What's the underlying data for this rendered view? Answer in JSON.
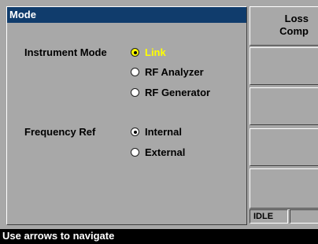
{
  "panel": {
    "title": "Mode",
    "instrument_mode": {
      "label": "Instrument Mode",
      "options": [
        "Link",
        "RF Analyzer",
        "RF Generator"
      ],
      "selected": "Link"
    },
    "frequency_ref": {
      "label": "Frequency Ref",
      "options": [
        "Internal",
        "External"
      ],
      "selected": "Internal"
    }
  },
  "softkeys": {
    "key1": {
      "line1": "Loss",
      "line2": "Comp"
    }
  },
  "status": {
    "state": "IDLE",
    "extra": ""
  },
  "hint": "Use arrows to navigate",
  "colors": {
    "title_bar": "#103c6c",
    "panel_bg": "#a8a8a8",
    "focus": "#ffff00",
    "hint_bar": "#000000"
  }
}
